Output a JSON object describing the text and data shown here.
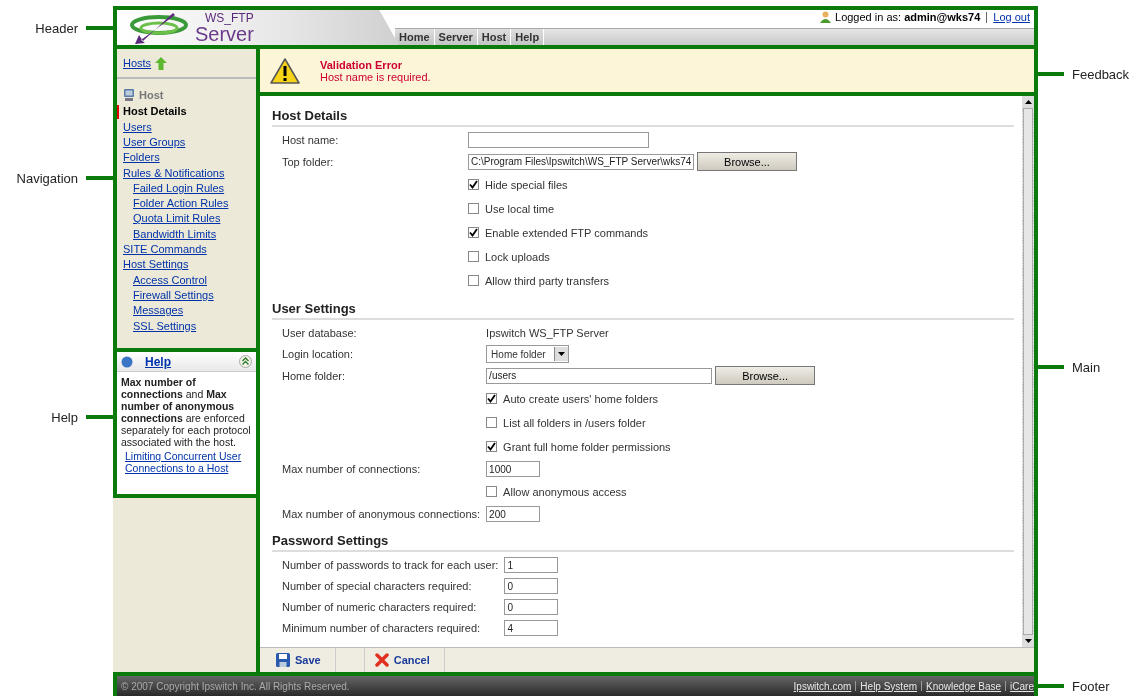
{
  "callouts": {
    "left": [
      {
        "label": "Header"
      },
      {
        "label": "Navigation"
      },
      {
        "label": "Help"
      }
    ],
    "right": [
      {
        "label": "Feedback"
      },
      {
        "label": "Main"
      },
      {
        "label": "Footer"
      }
    ]
  },
  "header": {
    "logo": {
      "line_1": "WS_FTP",
      "line_2": "Server"
    },
    "user": "Logged in as: **admin@wks74**",
    "logout": "Log out",
    "menu": [
      {
        "label": "Home"
      },
      {
        "label": "Server"
      },
      {
        "label": "Host"
      },
      {
        "label": "Help"
      }
    ]
  },
  "feedback": {
    "title": "Validation Error",
    "message": "Host name is required."
  },
  "navigation": {
    "up_link": "Hosts",
    "section": "Host",
    "items": [
      {
        "label": "Host Details",
        "selected": true
      },
      {
        "label": "Users",
        "selected": false
      },
      {
        "label": "User Groups",
        "selected": false
      },
      {
        "label": "Folders",
        "selected": false
      },
      {
        "label": "Rules & Notifications",
        "selected": false,
        "children": [
          {
            "label": "Failed Login Rules",
            "selected": false
          },
          {
            "label": "Folder Action Rules",
            "selected": false
          },
          {
            "label": "Quota Limit Rules",
            "selected": false
          },
          {
            "label": "Bandwidth Limits",
            "selected": false
          }
        ]
      },
      {
        "label": "SITE Commands",
        "selected": false
      },
      {
        "label": "Host Settings",
        "selected": false,
        "children": [
          {
            "label": "Access Control",
            "selected": false
          },
          {
            "label": "Firewall Settings",
            "selected": false
          },
          {
            "label": "Messages",
            "selected": false
          },
          {
            "label": "SSL Settings",
            "selected": false
          }
        ]
      }
    ]
  },
  "help": {
    "title": "Help",
    "text": "**Max number of connections** and **Max number of anonymous connections** are enforced separately for each protocol associated with the host.",
    "link": "Limiting Concurrent User Connections to a Host"
  },
  "main": {
    "sections": [
      {
        "title": "Host Details",
        "rows": [
          {
            "kind": "text",
            "label": "Host name:"
          },
          {
            "kind": "text",
            "label": "Top folder:",
            "value": "C:\\Program Files\\Ipswitch\\WS_FTP Server\\wks74",
            "button": "Browse..."
          },
          {
            "kind": "checkbox",
            "label": "Hide special files",
            "checked": true
          },
          {
            "kind": "checkbox",
            "label": "Use local time",
            "checked": false
          },
          {
            "kind": "checkbox",
            "label": "Enable extended FTP commands",
            "checked": true
          },
          {
            "kind": "checkbox",
            "label": "Lock uploads",
            "checked": false
          },
          {
            "kind": "checkbox",
            "label": "Allow third party transfers",
            "checked": false
          }
        ]
      },
      {
        "title": "User Settings",
        "rows": [
          {
            "kind": "static",
            "label": "User database:",
            "value": "Ipswitch WS_FTP Server"
          },
          {
            "kind": "select",
            "label": "Login location:",
            "value": "Home folder"
          },
          {
            "kind": "text",
            "label": "Home folder:",
            "value": "/users",
            "button": "Browse..."
          },
          {
            "kind": "checkbox",
            "label": "Auto create users' home folders",
            "checked": true
          },
          {
            "kind": "checkbox",
            "label": "List all folders in /users folder",
            "checked": false
          },
          {
            "kind": "checkbox",
            "label": "Grant full home folder permissions",
            "checked": true
          },
          {
            "kind": "short",
            "label": "Max number of connections:",
            "value": "1000"
          },
          {
            "kind": "checkbox",
            "label": "Allow anonymous access",
            "checked": false
          },
          {
            "kind": "short",
            "label": "Max number of anonymous connections:",
            "value": "200"
          }
        ]
      },
      {
        "title": "Password Settings",
        "rows": [
          {
            "kind": "short",
            "label": "Number of passwords to track for each user:",
            "value": "1"
          },
          {
            "kind": "short",
            "label": "Number of special characters required:",
            "value": "0"
          },
          {
            "kind": "short",
            "label": "Number of numeric characters required:",
            "value": "0"
          },
          {
            "kind": "short",
            "label": "Minimum number of characters required:",
            "value": "4"
          }
        ]
      }
    ],
    "toolbar": [
      {
        "kind": "save",
        "label": "Save"
      },
      {
        "kind": "cancel",
        "label": "Cancel"
      }
    ]
  },
  "footer": {
    "copyright": "© 2007 Copyright Ipswitch Inc. All Rights Reserved.",
    "links": [
      "Ipswitch.com",
      "Help System",
      "Knowledge Base",
      "iCare"
    ]
  }
}
